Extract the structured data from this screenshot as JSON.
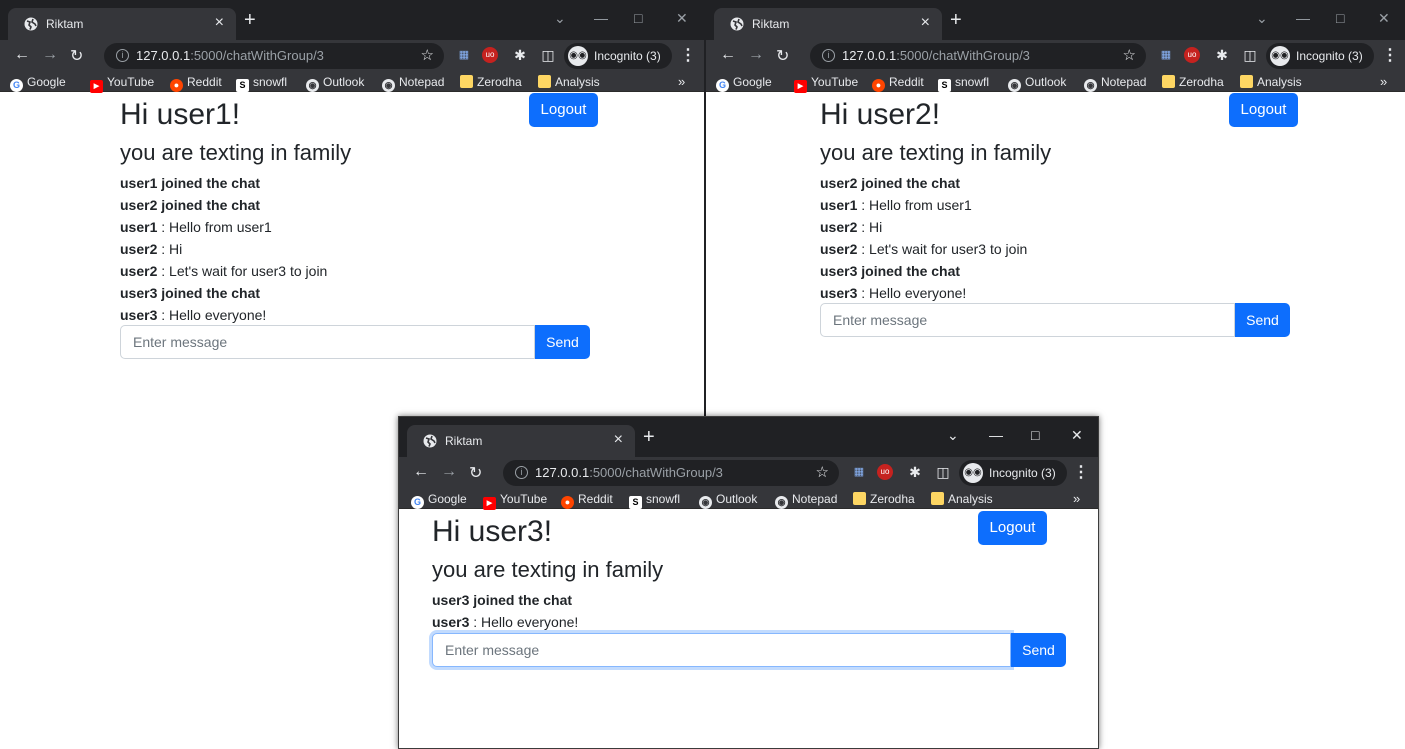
{
  "colors": {
    "primary": "#0d6efd",
    "chrome_dark": "#202124",
    "chrome_toolbar": "#35363a",
    "youtube_red": "#ff0000",
    "reddit_orange": "#ff4500",
    "folder_yellow": "#fdd663"
  },
  "browser": {
    "tab_title": "Riktam",
    "close_glyph": "×",
    "newtab_glyph": "+",
    "url_host": "127.0.0.1",
    "url_path": ":5000/chatWithGroup/3",
    "incognito_label": "Incognito (3)",
    "bookmarks": [
      "Google",
      "YouTube",
      "Reddit",
      "snowfl",
      "Outlook",
      "Notepad",
      "Zerodha",
      "Analysis"
    ],
    "bookmarks_more": "»"
  },
  "windows": [
    {
      "greeting": "Hi user1!",
      "group_line": "you are texting in family",
      "logout_label": "Logout",
      "messages": [
        {
          "type": "system",
          "text": "user1 joined the chat"
        },
        {
          "type": "system",
          "text": "user2 joined the chat"
        },
        {
          "type": "chat",
          "sender": "user1",
          "text": " : Hello from user1"
        },
        {
          "type": "chat",
          "sender": "user2",
          "text": " : Hi"
        },
        {
          "type": "chat",
          "sender": "user2",
          "text": " : Let's wait for user3 to join"
        },
        {
          "type": "system",
          "text": "user3 joined the chat"
        },
        {
          "type": "chat",
          "sender": "user3",
          "text": " : Hello everyone!"
        }
      ],
      "input_placeholder": "Enter message",
      "send_label": "Send"
    },
    {
      "greeting": "Hi user2!",
      "group_line": "you are texting in family",
      "logout_label": "Logout",
      "messages": [
        {
          "type": "system",
          "text": "user2 joined the chat"
        },
        {
          "type": "chat",
          "sender": "user1",
          "text": " : Hello from user1"
        },
        {
          "type": "chat",
          "sender": "user2",
          "text": " : Hi"
        },
        {
          "type": "chat",
          "sender": "user2",
          "text": " : Let's wait for user3 to join"
        },
        {
          "type": "system",
          "text": "user3 joined the chat"
        },
        {
          "type": "chat",
          "sender": "user3",
          "text": " : Hello everyone!"
        }
      ],
      "input_placeholder": "Enter message",
      "send_label": "Send"
    },
    {
      "greeting": "Hi user3!",
      "group_line": "you are texting in family",
      "logout_label": "Logout",
      "messages": [
        {
          "type": "system",
          "text": "user3 joined the chat"
        },
        {
          "type": "chat",
          "sender": "user3",
          "text": " : Hello everyone!"
        }
      ],
      "input_placeholder": "Enter message",
      "send_label": "Send"
    }
  ]
}
